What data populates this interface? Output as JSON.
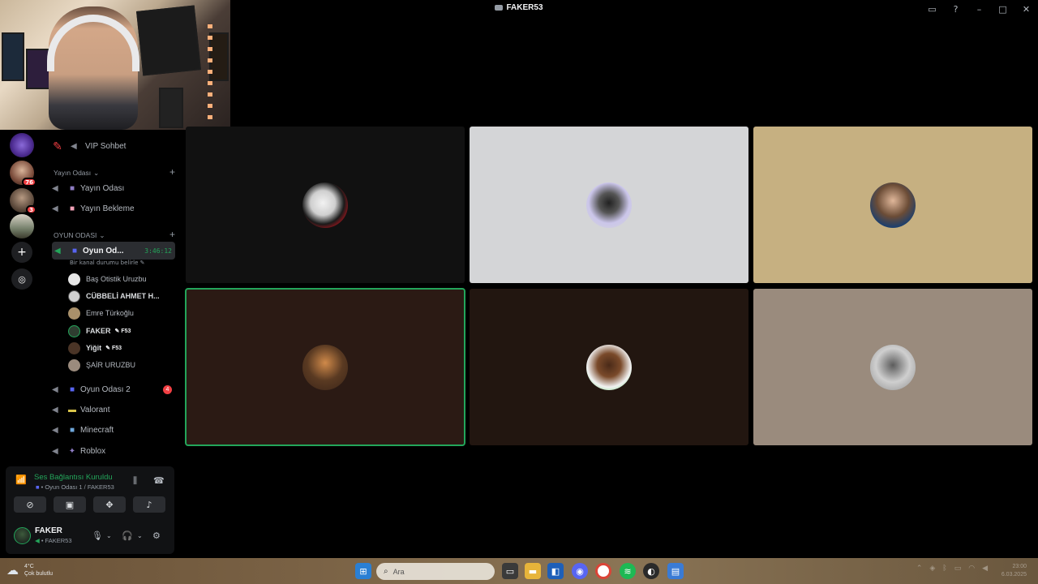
{
  "window": {
    "title": "FAKER53"
  },
  "servers": {
    "badge_1": "76",
    "badge_2": "3"
  },
  "channels": {
    "top_channel": "VIP Sohbet",
    "category_1": "Yayın Odası",
    "cat1_items": [
      "Yayın Odası",
      "Yayın Bekleme"
    ],
    "category_2": "OYUN ODASI",
    "active_channel": "Oyun Od...",
    "active_timer": "3:46:12",
    "active_status": "Bir kanal durumu belirle",
    "members": [
      {
        "name": "Baş Otistik Uruzbu",
        "tag": ""
      },
      {
        "name": "CÜBBELİ AHMET H...",
        "tag": ""
      },
      {
        "name": "Emre Türkoğlu",
        "tag": ""
      },
      {
        "name": "FAKER",
        "tag": "F53"
      },
      {
        "name": "Yiğit",
        "tag": "F53"
      },
      {
        "name": "ŞAİR URUZBU",
        "tag": ""
      }
    ],
    "other_channels": [
      {
        "label": "Oyun Odası 2",
        "count": "4"
      },
      {
        "label": "Valorant",
        "count": ""
      },
      {
        "label": "Minecraft",
        "count": ""
      },
      {
        "label": "Roblox",
        "count": ""
      }
    ]
  },
  "voice_panel": {
    "status": "Ses Bağlantısı Kuruldu",
    "location": "Oyun Odası 1 / FAKER53",
    "user_name": "FAKER",
    "user_sub": "FAKER53"
  },
  "taskbar": {
    "search_placeholder": "Ara",
    "weather_line1": "4°C",
    "weather_line2": "Çok bulutlu",
    "time": "23:00",
    "date": "6.03.2025"
  },
  "colors": {
    "green": "#23a55a",
    "accent": "#5865f2",
    "tile_1": "#111111",
    "tile_2": "#d4d5d7",
    "tile_3": "#c6b081",
    "tile_4": "#2b1a14",
    "tile_5": "#221610",
    "tile_6": "#9a8b7d"
  }
}
